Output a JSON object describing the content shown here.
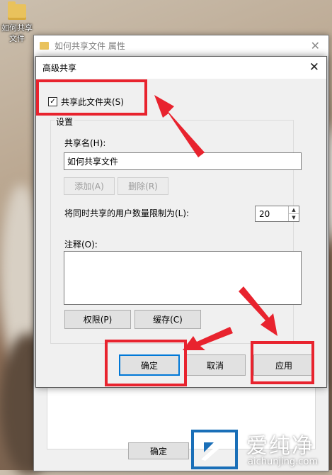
{
  "desktop": {
    "icon_label": "如何共享文件"
  },
  "properties_window": {
    "title": "如何共享文件 属性",
    "ok_label": "确定"
  },
  "dialog": {
    "title": "高级共享",
    "share_checkbox_label": "共享此文件夹(S)",
    "share_checked": true,
    "settings_group_label": "设置",
    "share_name_label": "共享名(H):",
    "share_name_value": "如何共享文件",
    "add_label": "添加(A)",
    "remove_label": "删除(R)",
    "user_limit_label": "将同时共享的用户数量限制为(L):",
    "user_limit_value": "20",
    "comment_label": "注释(O):",
    "permissions_label": "权限(P)",
    "caching_label": "缓存(C)",
    "ok_label": "确定",
    "cancel_label": "取消",
    "apply_label": "应用"
  },
  "watermark": {
    "name": "爱纯净",
    "url": "aichunjing.com"
  },
  "colors": {
    "annotation_red": "#e8232e",
    "focus_blue": "#0078d7"
  }
}
